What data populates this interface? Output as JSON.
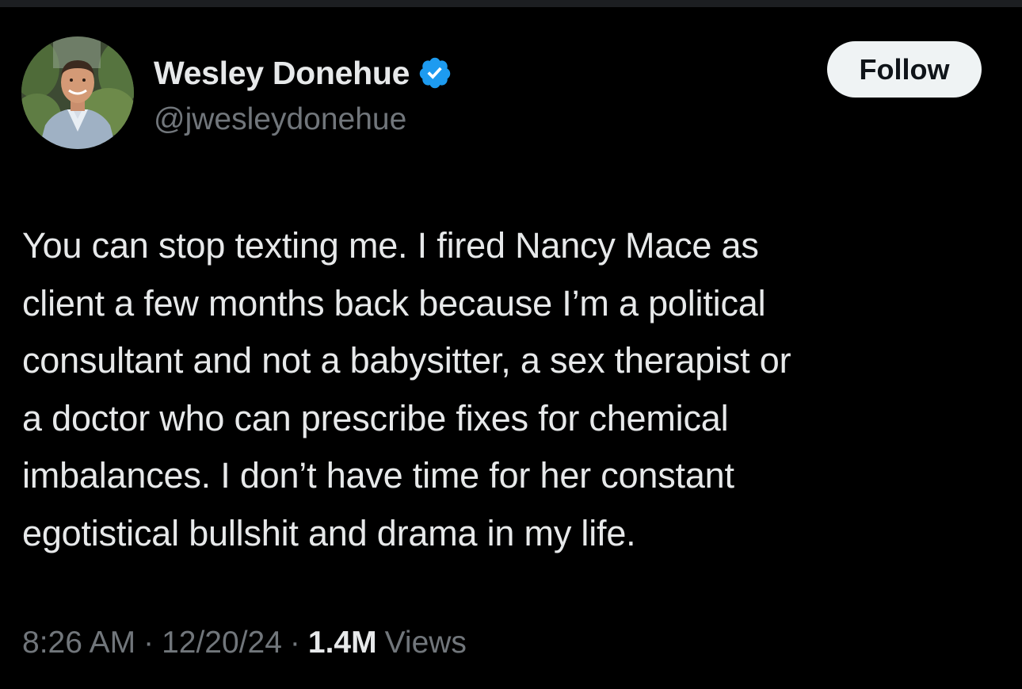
{
  "tweet": {
    "author": {
      "display_name": "Wesley Donehue",
      "handle": "@jwesleydonehue",
      "verified": true,
      "verified_color": "#1d9bf0"
    },
    "follow_label": "Follow",
    "text": "You can stop texting me. I fired Nancy Mace as\nclient a few months back because I’m a political\nconsultant and not a babysitter, a sex therapist or\na doctor who can prescribe fixes for chemical\nimbalances. I don’t have time for her constant\negotistical bullshit and drama in my life.",
    "time": "8:26 AM",
    "separator": "·",
    "date": "12/20/24",
    "views_count": "1.4M",
    "views_label": "Views"
  },
  "icons": {
    "verified": "verified-badge-icon",
    "avatar": "profile-photo"
  },
  "colors": {
    "background": "#000000",
    "text_primary": "#e7e9ea",
    "text_secondary": "#71767b",
    "follow_button_bg": "#eff3f4",
    "follow_button_text": "#0f1419"
  }
}
